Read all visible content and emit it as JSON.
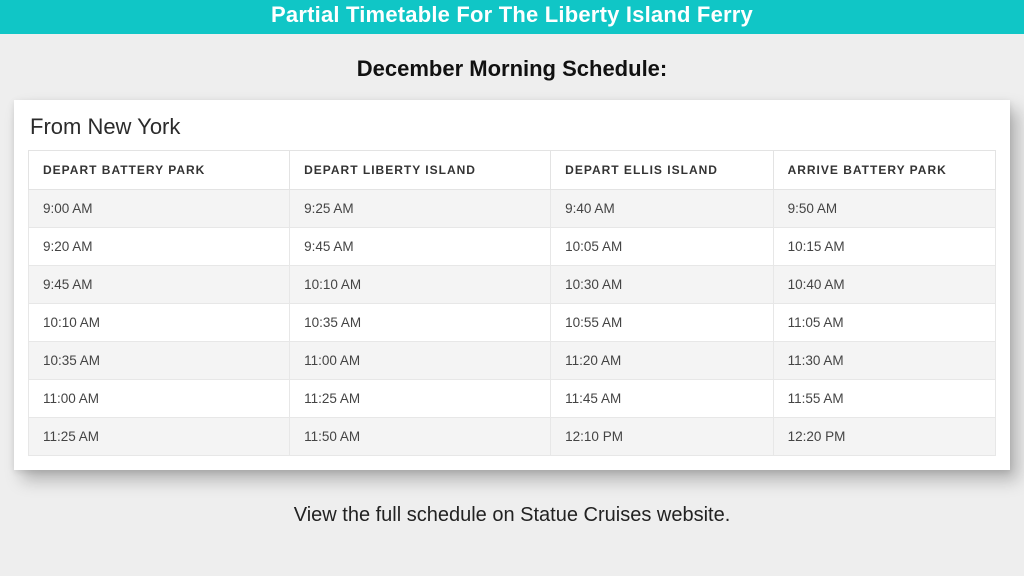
{
  "banner": {
    "title": "Partial Timetable For The Liberty Island Ferry"
  },
  "subtitle": "December Morning Schedule:",
  "card": {
    "title": "From New York"
  },
  "footer": "View the full schedule on Statue Cruises website.",
  "chart_data": {
    "type": "table",
    "headers": [
      "DEPART BATTERY PARK",
      "DEPART LIBERTY ISLAND",
      "DEPART ELLIS ISLAND",
      "ARRIVE BATTERY PARK"
    ],
    "rows": [
      [
        "9:00 AM",
        "9:25 AM",
        "9:40 AM",
        "9:50 AM"
      ],
      [
        "9:20 AM",
        "9:45 AM",
        "10:05 AM",
        "10:15 AM"
      ],
      [
        "9:45 AM",
        "10:10 AM",
        "10:30 AM",
        "10:40 AM"
      ],
      [
        "10:10 AM",
        "10:35 AM",
        "10:55 AM",
        "11:05 AM"
      ],
      [
        "10:35 AM",
        "11:00 AM",
        "11:20 AM",
        "11:30 AM"
      ],
      [
        "11:00 AM",
        "11:25 AM",
        "11:45 AM",
        "11:55 AM"
      ],
      [
        "11:25 AM",
        "11:50 AM",
        "12:10 PM",
        "12:20 PM"
      ]
    ]
  }
}
